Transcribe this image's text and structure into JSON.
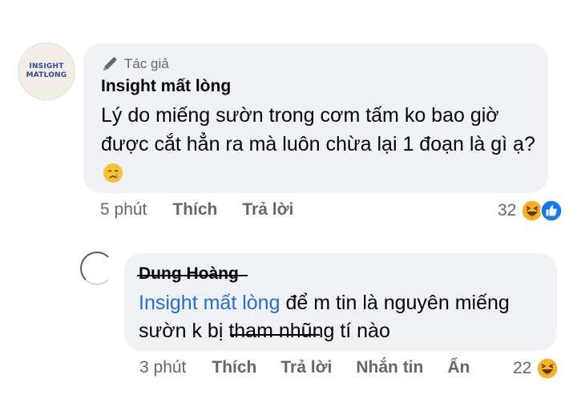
{
  "main_comment": {
    "avatar": {
      "logo_line1": "INSIGHT",
      "logo_line2": "MATLONG"
    },
    "author_badge": "Tác giả",
    "author_name": "Insight mất lòng",
    "text": "Lý do miếng sườn trong cơm tấm ko bao giờ được cắt hẳn ra mà luôn chừa lại 1 đoạn là gì ạ?",
    "emoji": "crying-face",
    "time": "5 phút",
    "like_label": "Thích",
    "reply_label": "Trả lời",
    "reaction_count": "32",
    "reactions": [
      "haha",
      "like"
    ]
  },
  "reply_comment": {
    "author_name": "Dung Hoàng",
    "mention": "Insight mất lòng",
    "text": " để m tin là nguyên miếng sườn k bị tham nhũng tí nào",
    "time": "3 phút",
    "like_label": "Thích",
    "reply_label": "Trả lời",
    "message_label": "Nhắn tin",
    "hide_label": "Ẩn",
    "reaction_count": "22",
    "reactions": [
      "haha"
    ]
  },
  "colors": {
    "bubble": "#f0f2f5",
    "secondary_text": "#65676b",
    "mention": "#216fdb",
    "haha": "#f7b125",
    "like": "#1877f2"
  }
}
